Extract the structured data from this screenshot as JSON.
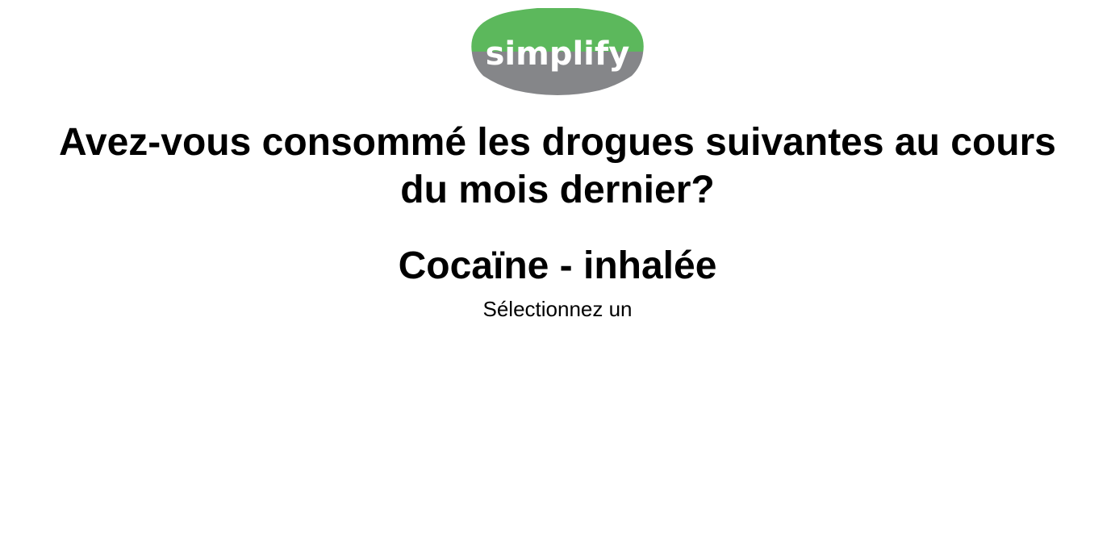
{
  "logo": {
    "text": "simplify",
    "colors": {
      "top": "#5cb85c",
      "bottom": "#858689",
      "text": "#ffffff"
    }
  },
  "question": {
    "text": "Avez-vous consommé les drogues suivantes au cours du mois dernier?"
  },
  "item": {
    "title": "Cocaïne - inhalée"
  },
  "instruction": {
    "text": "Sélectionnez un"
  }
}
